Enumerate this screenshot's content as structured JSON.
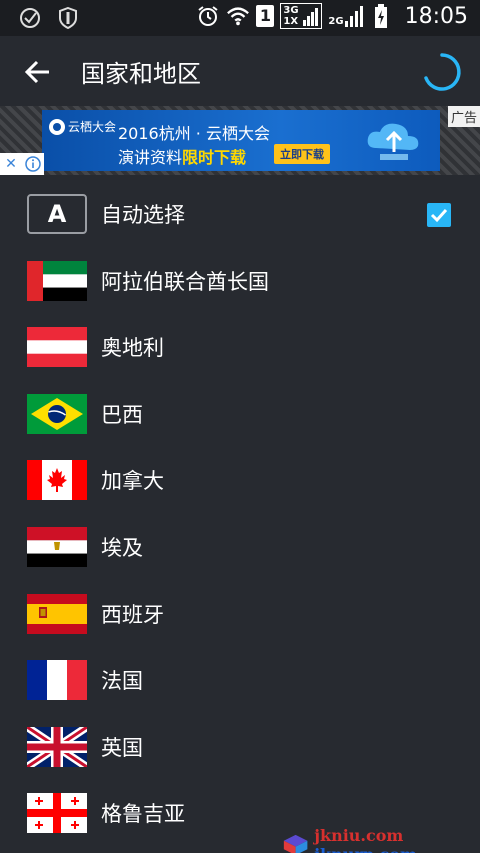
{
  "status_bar": {
    "time": "18:05",
    "sim_badge": "1",
    "net_top": "3G",
    "net_bottom": "1X",
    "net2": "2G"
  },
  "app_bar": {
    "title": "国家和地区"
  },
  "ad": {
    "logo_text": "云栖大会",
    "line1": "2016杭州 · 云栖大会",
    "line2_prefix": "演讲资料",
    "line2_highlight": "限时下载",
    "button": "立即下载",
    "label": "广告"
  },
  "auto_select": {
    "icon_letter": "A",
    "label": "自动选择",
    "checked": true
  },
  "countries": [
    {
      "label": "阿拉伯联合酋长国",
      "flag": "uae"
    },
    {
      "label": "奥地利",
      "flag": "austria"
    },
    {
      "label": "巴西",
      "flag": "brazil"
    },
    {
      "label": "加拿大",
      "flag": "canada"
    },
    {
      "label": "埃及",
      "flag": "egypt"
    },
    {
      "label": "西班牙",
      "flag": "spain"
    },
    {
      "label": "法国",
      "flag": "france"
    },
    {
      "label": "英国",
      "flag": "uk"
    },
    {
      "label": "格鲁吉亚",
      "flag": "georgia"
    }
  ],
  "watermark": {
    "text_red": "jkniu.com",
    "text_blue": "jknurp.com"
  },
  "colors": {
    "background": "#272a30",
    "accent": "#29b6f6"
  }
}
